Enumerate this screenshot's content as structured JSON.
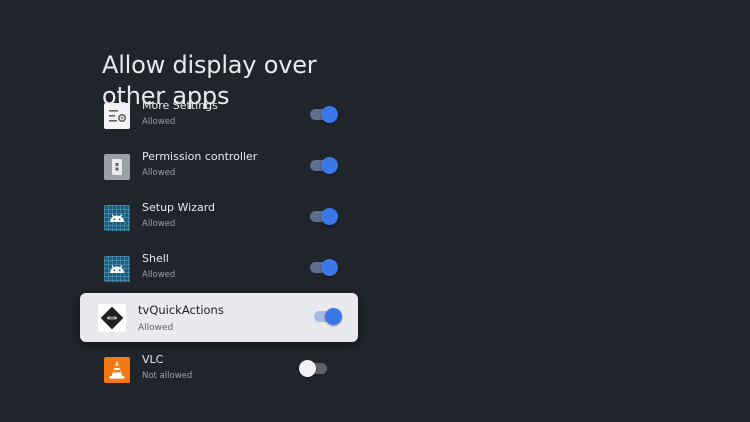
{
  "page": {
    "title": "Allow display over other apps"
  },
  "apps": [
    {
      "name": "More Settings",
      "status": "Allowed",
      "enabled": true,
      "icon": "settings-sliders-icon"
    },
    {
      "name": "Permission controller",
      "status": "Allowed",
      "enabled": true,
      "icon": "permission-controller-icon"
    },
    {
      "name": "Setup Wizard",
      "status": "Allowed",
      "enabled": true,
      "icon": "android-icon"
    },
    {
      "name": "Shell",
      "status": "Allowed",
      "enabled": true,
      "icon": "android-icon"
    },
    {
      "name": "tvQuickActions",
      "status": "Allowed",
      "enabled": true,
      "focused": true,
      "icon": "tvquickactions-icon"
    },
    {
      "name": "VLC",
      "status": "Not allowed",
      "enabled": false,
      "icon": "vlc-cone-icon"
    }
  ],
  "colors": {
    "background": "#20242b",
    "accent": "#3b78e7",
    "focus_card": "#e8eaed",
    "vlc_orange": "#f07a15"
  }
}
